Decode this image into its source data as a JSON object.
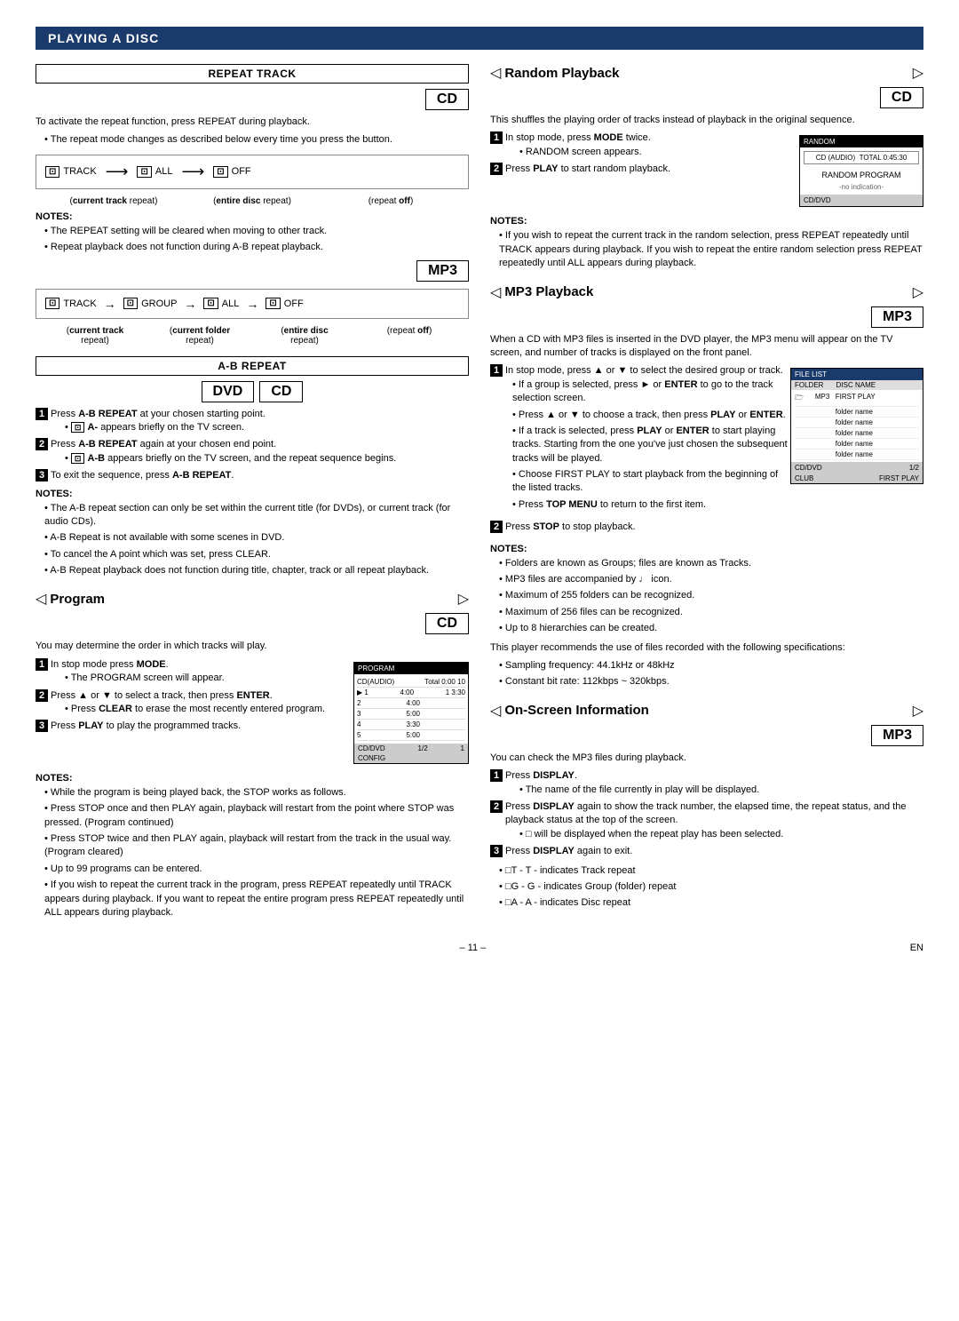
{
  "page": {
    "header": "PLAYING A DISC",
    "page_number": "– 11 –",
    "en_label": "EN"
  },
  "repeat_track": {
    "title": "REPEAT TRACK",
    "badge": "CD",
    "intro": "To activate the repeat function, press REPEAT during playback.",
    "bullet": "The repeat mode changes as described below every time you press the button.",
    "diagram_cd": {
      "items": [
        "TRACK",
        "ALL",
        "OFF"
      ],
      "labels": [
        "(current track repeat)",
        "(entire disc repeat)",
        "(repeat off)"
      ]
    },
    "notes_title": "NOTES:",
    "notes": [
      "The REPEAT setting will be cleared when moving to other track.",
      "Repeat playback does not function during A-B repeat playback."
    ],
    "mp3_badge": "MP3",
    "diagram_mp3": {
      "items": [
        "TRACK",
        "GROUP",
        "ALL",
        "OFF"
      ],
      "labels": [
        "current track repeat)",
        "(current folder repeat)",
        "(entire disc repeat)",
        "(repeat off)"
      ]
    },
    "mp3_labels": [
      "current track",
      "current folder",
      "entire disc",
      ""
    ]
  },
  "ab_repeat": {
    "title": "A-B REPEAT",
    "badge_dvd": "DVD",
    "badge_cd": "CD",
    "steps": [
      {
        "num": "1",
        "text": "Press A-B REPEAT at your chosen starting point.",
        "sub": "A- appears briefly on the TV screen."
      },
      {
        "num": "2",
        "text": "Press A-B REPEAT again at your chosen end point.",
        "sub": "A-B appears briefly on the TV screen, and the repeat sequence begins."
      },
      {
        "num": "3",
        "text": "To exit the sequence, press A-B REPEAT."
      }
    ],
    "notes_title": "NOTES:",
    "notes": [
      "The A-B repeat section can only be set within the current title (for DVDs), or current track (for audio CDs).",
      "A-B Repeat is not available with some scenes in DVD.",
      "To cancel the A point which was set, press CLEAR.",
      "A-B Repeat playback does not function during title, chapter, track or all repeat playback."
    ]
  },
  "program": {
    "title": "Program",
    "badge": "CD",
    "intro": "You may determine the order in which tracks will play.",
    "steps": [
      {
        "num": "1",
        "text": "In stop mode press MODE.",
        "sub": "The PROGRAM screen will appear."
      },
      {
        "num": "2",
        "text": "Press ▲ or ▼ to select a track, then press ENTER.",
        "sub": "Press CLEAR to erase the most recently entered program."
      },
      {
        "num": "3",
        "text": "Press PLAY to play the programmed tracks."
      }
    ],
    "notes_title": "NOTES:",
    "notes": [
      "While the program is being played back, the STOP works as follows.",
      "Press STOP once and then PLAY again, playback will restart from the point where STOP was pressed. (Program continued)",
      "Press STOP twice and then PLAY again, playback will restart from the track in the usual way. (Program cleared)",
      "Up to 99 programs can be entered.",
      "If you wish to repeat the current track in the program, press REPEAT repeatedly until TRACK appears during playback. If you want to repeat the entire program press REPEAT repeatedly until ALL appears during playback."
    ]
  },
  "random_playback": {
    "title": "Random Playback",
    "badge": "CD",
    "intro": "This shuffles the playing order of tracks instead of playback in the original sequence.",
    "steps": [
      {
        "num": "1",
        "text": "In stop mode, press MODE twice.",
        "sub": "RANDOM screen appears."
      },
      {
        "num": "2",
        "text": "Press PLAY to start random playback."
      }
    ],
    "notes_title": "NOTES:",
    "notes": [
      "If you wish to repeat the current track in the random selection, press REPEAT repeatedly until TRACK appears during playback. If you wish to repeat the entire random selection press REPEAT repeatedly until ALL appears during playback."
    ]
  },
  "mp3_playback": {
    "title": "MP3 Playback",
    "badge": "MP3",
    "intro": "When a CD with MP3 files is inserted in the DVD player, the MP3 menu will appear on the TV screen, and number of tracks is displayed on the front panel.",
    "steps": [
      {
        "num": "1",
        "text": "In stop mode, press ▲ or ▼ to select the desired group or track.",
        "subs": [
          "If a group is selected, press ► or ENTER to go to the track selection screen.",
          "Press ▲ or ▼ to choose a track, then press PLAY or ENTER.",
          "If a track is selected, press PLAY or ENTER to start playing tracks. Starting from the one you've just chosen the subsequent tracks will be played.",
          "Choose FIRST PLAY to start playback from the beginning of the listed tracks.",
          "Press TOP MENU to return to the first item."
        ]
      },
      {
        "num": "2",
        "text": "Press STOP to stop playback."
      }
    ],
    "notes_title": "NOTES:",
    "notes": [
      "Folders are known as Groups; files are known as Tracks.",
      "MP3 files are accompanied by ♩ icon.",
      "Maximum of 255 folders can be recognized.",
      "Maximum of 256 files can be recognized.",
      "Up to 8 hierarchies can be created."
    ],
    "footer_intro": "This player recommends the use of files recorded with the following specifications:",
    "footer_notes": [
      "Sampling frequency: 44.1kHz or 48kHz",
      "Constant bit rate: 112kbps ~ 320kbps."
    ]
  },
  "on_screen_info": {
    "title": "On-Screen Information",
    "badge": "MP3",
    "intro": "You can check the MP3 files during playback.",
    "steps": [
      {
        "num": "1",
        "text": "Press DISPLAY.",
        "sub": "The name of the file currently in play will be displayed."
      },
      {
        "num": "2",
        "text": "Press DISPLAY again to show the track number, the elapsed time, the repeat status, and the playback status at the top of the screen.",
        "sub": "□ will be displayed when the repeat play has been selected."
      },
      {
        "num": "3",
        "text": "Press DISPLAY again to exit."
      }
    ],
    "notes": [
      "T - indicates Track repeat",
      "G - indicates Group (folder) repeat",
      "A - indicates Disc repeat"
    ]
  }
}
